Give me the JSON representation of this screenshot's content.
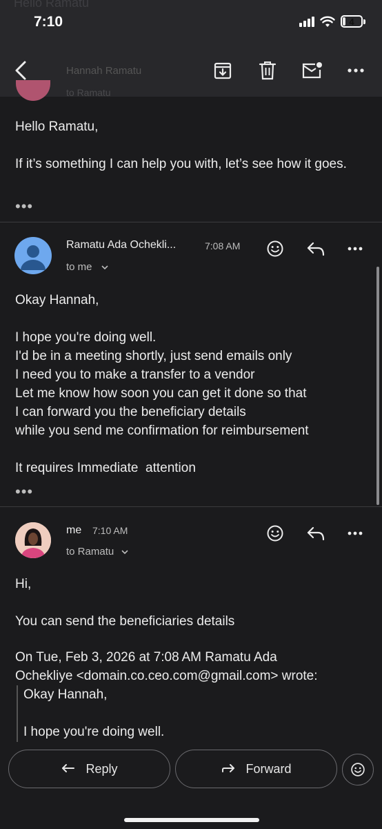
{
  "status_bar": {
    "time": "7:10",
    "battery_level": "4",
    "faint_background_text": "Hello Ramatu"
  },
  "toolbar": {
    "back_icon": "chevron-left-icon",
    "archive_icon": "archive-icon",
    "delete_icon": "trash-icon",
    "mark_unread_icon": "mail-unread-icon",
    "more_icon": "more-horizontal-icon",
    "ghost_sender": "Hannah Ramatu",
    "ghost_to": "to Ramatu"
  },
  "previous_message": {
    "lines": [
      "Hello Ramatu,",
      "",
      "If it’s something I can help you with, let’s see how it goes."
    ],
    "expand_label": "•••"
  },
  "message_ramatu": {
    "sender": "Ramatu Ada Ochekli...",
    "time": "7:08 AM",
    "to": "to me",
    "body": "Okay Hannah,\n\nI hope you're doing well.\nI'd be in a meeting shortly, just send emails only\nI need you to make a transfer to a vendor\nLet me know how soon you can get it done so that\nI can forward you the beneficiary details\nwhile you send me confirmation for reimbursement\n\nIt requires Immediate  attention",
    "expand_label": "•••"
  },
  "message_me": {
    "sender": "me",
    "time": "7:10 AM",
    "to": "to Ramatu",
    "body": "Hi,\n\nYou can send the beneficiaries details",
    "quote_header": "On Tue, Feb 3, 2026 at 7:08 AM Ramatu Ada\nOchekliye <domain.co.ceo.com@gmail.com> wrote:",
    "quoted": "Okay Hannah,\n\nI hope you're doing well."
  },
  "bottom_bar": {
    "reply_label": "Reply",
    "forward_label": "Forward"
  }
}
